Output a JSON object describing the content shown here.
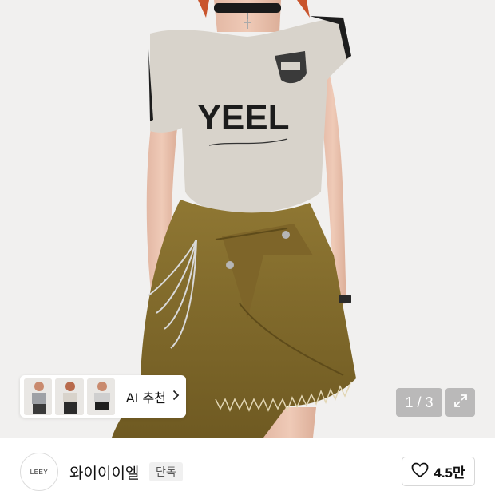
{
  "product_image": {
    "shirt_print": "YEEL",
    "ai_recommend": {
      "label": "AI 추천",
      "thumb_count": 3
    },
    "pager": "1 / 3"
  },
  "brand": {
    "logo_text": "LEEY",
    "name": "와이이이엘",
    "badge": "단독"
  },
  "like": {
    "count": "4.5만"
  },
  "icons": [
    "chevron-right-icon",
    "expand-icon",
    "heart-icon"
  ],
  "colors": {
    "background": "#f1f0ef",
    "skirt": "#8a6f2e",
    "shirt": "#d8d3cb"
  }
}
